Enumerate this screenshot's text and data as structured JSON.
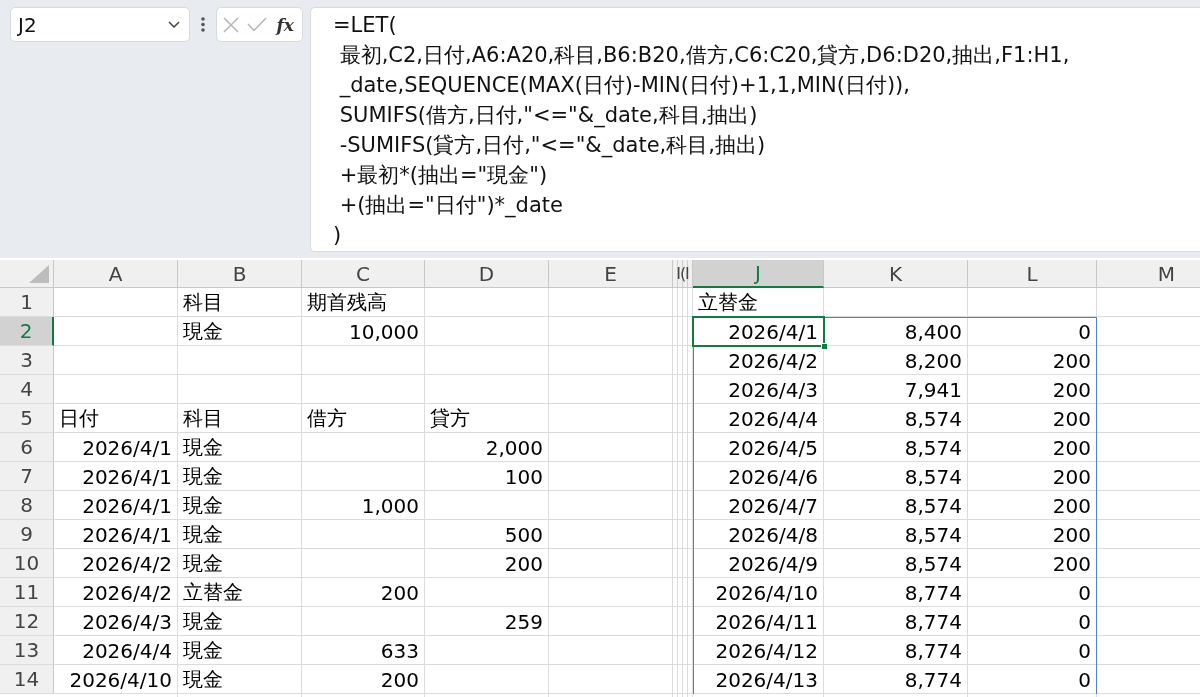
{
  "formula_bar": {
    "name_box": "J2",
    "buttons": [
      {
        "kind": "cancel",
        "disabled": true
      },
      {
        "kind": "enter",
        "disabled": true
      },
      {
        "kind": "function",
        "label": "fx",
        "disabled": false
      }
    ],
    "formula": "=LET(\n 最初,C2,日付,A6:A20,科目,B6:B20,借方,C6:C20,貸方,D6:D20,抽出,F1:H1,\n _date,SEQUENCE(MAX(日付)-MIN(日付)+1,1,MIN(日付)),\n SUMIFS(借方,日付,\"<=\"&_date,科目,抽出)\n -SUMIFS(貸方,日付,\"<=\"&_date,科目,抽出)\n +最初*(抽出=\"現金\")\n +(抽出=\"日付\")*_date\n)"
  },
  "grid": {
    "columns": [
      {
        "label": "A",
        "kind": "normal",
        "selected": false,
        "spill": false
      },
      {
        "label": "B",
        "kind": "normal",
        "selected": false,
        "spill": false
      },
      {
        "label": "C",
        "kind": "normal",
        "selected": false,
        "spill": false
      },
      {
        "label": "D",
        "kind": "normal",
        "selected": false,
        "spill": false
      },
      {
        "label": "E",
        "kind": "normal",
        "selected": false,
        "spill": false
      },
      {
        "label": "I(I",
        "kind": "collapsed",
        "selected": false,
        "spill": false
      },
      {
        "label": "J",
        "kind": "normal",
        "selected": true,
        "spill": true
      },
      {
        "label": "K",
        "kind": "normal",
        "selected": false,
        "spill": true
      },
      {
        "label": "L",
        "kind": "normal",
        "selected": false,
        "spill": true
      },
      {
        "label": "M",
        "kind": "normal",
        "selected": false,
        "spill": false
      }
    ],
    "rows": [
      {
        "label": "1",
        "selected": false,
        "spill": false,
        "cells": [
          null,
          {
            "kind": "text",
            "text": "科目"
          },
          {
            "kind": "text",
            "text": "期首残高"
          },
          null,
          null,
          null,
          {
            "kind": "text",
            "text": "立替金"
          },
          null,
          null,
          null
        ]
      },
      {
        "label": "2",
        "selected": true,
        "spill": true,
        "cells": [
          null,
          {
            "kind": "text",
            "text": "現金"
          },
          {
            "kind": "number",
            "text": "10,000"
          },
          null,
          null,
          null,
          {
            "kind": "date",
            "text": "2026/4/1"
          },
          {
            "kind": "number",
            "text": "8,400"
          },
          {
            "kind": "number",
            "text": "0"
          },
          null
        ]
      },
      {
        "label": "3",
        "selected": false,
        "spill": true,
        "cells": [
          null,
          null,
          null,
          null,
          null,
          null,
          {
            "kind": "date",
            "text": "2026/4/2"
          },
          {
            "kind": "number",
            "text": "8,200"
          },
          {
            "kind": "number",
            "text": "200"
          },
          null
        ]
      },
      {
        "label": "4",
        "selected": false,
        "spill": true,
        "cells": [
          null,
          null,
          null,
          null,
          null,
          null,
          {
            "kind": "date",
            "text": "2026/4/3"
          },
          {
            "kind": "number",
            "text": "7,941"
          },
          {
            "kind": "number",
            "text": "200"
          },
          null
        ]
      },
      {
        "label": "5",
        "selected": false,
        "spill": true,
        "cells": [
          {
            "kind": "text",
            "text": "日付"
          },
          {
            "kind": "text",
            "text": "科目"
          },
          {
            "kind": "text",
            "text": "借方"
          },
          {
            "kind": "text",
            "text": "貸方"
          },
          null,
          null,
          {
            "kind": "date",
            "text": "2026/4/4"
          },
          {
            "kind": "number",
            "text": "8,574"
          },
          {
            "kind": "number",
            "text": "200"
          },
          null
        ]
      },
      {
        "label": "6",
        "selected": false,
        "spill": true,
        "cells": [
          {
            "kind": "date",
            "text": "2026/4/1"
          },
          {
            "kind": "text",
            "text": "現金"
          },
          null,
          {
            "kind": "number",
            "text": "2,000"
          },
          null,
          null,
          {
            "kind": "date",
            "text": "2026/4/5"
          },
          {
            "kind": "number",
            "text": "8,574"
          },
          {
            "kind": "number",
            "text": "200"
          },
          null
        ]
      },
      {
        "label": "7",
        "selected": false,
        "spill": true,
        "cells": [
          {
            "kind": "date",
            "text": "2026/4/1"
          },
          {
            "kind": "text",
            "text": "現金"
          },
          null,
          {
            "kind": "number",
            "text": "100"
          },
          null,
          null,
          {
            "kind": "date",
            "text": "2026/4/6"
          },
          {
            "kind": "number",
            "text": "8,574"
          },
          {
            "kind": "number",
            "text": "200"
          },
          null
        ]
      },
      {
        "label": "8",
        "selected": false,
        "spill": true,
        "cells": [
          {
            "kind": "date",
            "text": "2026/4/1"
          },
          {
            "kind": "text",
            "text": "現金"
          },
          {
            "kind": "number",
            "text": "1,000"
          },
          null,
          null,
          null,
          {
            "kind": "date",
            "text": "2026/4/7"
          },
          {
            "kind": "number",
            "text": "8,574"
          },
          {
            "kind": "number",
            "text": "200"
          },
          null
        ]
      },
      {
        "label": "9",
        "selected": false,
        "spill": true,
        "cells": [
          {
            "kind": "date",
            "text": "2026/4/1"
          },
          {
            "kind": "text",
            "text": "現金"
          },
          null,
          {
            "kind": "number",
            "text": "500"
          },
          null,
          null,
          {
            "kind": "date",
            "text": "2026/4/8"
          },
          {
            "kind": "number",
            "text": "8,574"
          },
          {
            "kind": "number",
            "text": "200"
          },
          null
        ]
      },
      {
        "label": "10",
        "selected": false,
        "spill": true,
        "cells": [
          {
            "kind": "date",
            "text": "2026/4/2"
          },
          {
            "kind": "text",
            "text": "現金"
          },
          null,
          {
            "kind": "number",
            "text": "200"
          },
          null,
          null,
          {
            "kind": "date",
            "text": "2026/4/9"
          },
          {
            "kind": "number",
            "text": "8,574"
          },
          {
            "kind": "number",
            "text": "200"
          },
          null
        ]
      },
      {
        "label": "11",
        "selected": false,
        "spill": true,
        "cells": [
          {
            "kind": "date",
            "text": "2026/4/2"
          },
          {
            "kind": "text",
            "text": "立替金"
          },
          {
            "kind": "number",
            "text": "200"
          },
          null,
          null,
          null,
          {
            "kind": "date",
            "text": "2026/4/10"
          },
          {
            "kind": "number",
            "text": "8,774"
          },
          {
            "kind": "number",
            "text": "0"
          },
          null
        ]
      },
      {
        "label": "12",
        "selected": false,
        "spill": true,
        "cells": [
          {
            "kind": "date",
            "text": "2026/4/3"
          },
          {
            "kind": "text",
            "text": "現金"
          },
          null,
          {
            "kind": "number",
            "text": "259"
          },
          null,
          null,
          {
            "kind": "date",
            "text": "2026/4/11"
          },
          {
            "kind": "number",
            "text": "8,774"
          },
          {
            "kind": "number",
            "text": "0"
          },
          null
        ]
      },
      {
        "label": "13",
        "selected": false,
        "spill": true,
        "cells": [
          {
            "kind": "date",
            "text": "2026/4/4"
          },
          {
            "kind": "text",
            "text": "現金"
          },
          {
            "kind": "number",
            "text": "633"
          },
          null,
          null,
          null,
          {
            "kind": "date",
            "text": "2026/4/12"
          },
          {
            "kind": "number",
            "text": "8,774"
          },
          {
            "kind": "number",
            "text": "0"
          },
          null
        ]
      },
      {
        "label": "14",
        "selected": false,
        "spill": true,
        "cells": [
          {
            "kind": "date",
            "text": "2026/4/10"
          },
          {
            "kind": "text",
            "text": "現金"
          },
          {
            "kind": "number",
            "text": "200"
          },
          null,
          null,
          null,
          {
            "kind": "date",
            "text": "2026/4/13"
          },
          {
            "kind": "number",
            "text": "8,774"
          },
          {
            "kind": "number",
            "text": "0"
          },
          null
        ]
      }
    ]
  }
}
